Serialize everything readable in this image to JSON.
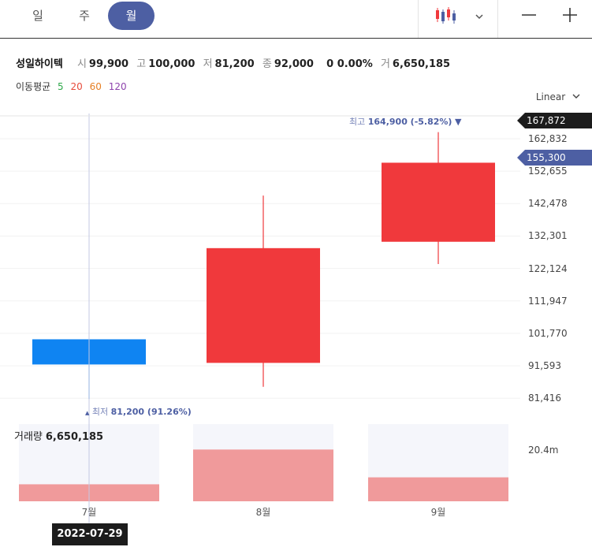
{
  "toolbar": {
    "tabs": [
      {
        "label": "일",
        "active": false
      },
      {
        "label": "주",
        "active": false
      },
      {
        "label": "월",
        "active": true
      }
    ],
    "chart_type_icon": "candlestick-icon",
    "dropdown_icon": "chevron-down-icon",
    "zoom_out_icon": "minus-icon",
    "zoom_in_icon": "plus-icon"
  },
  "quote": {
    "name": "성일하이텍",
    "open_label": "시",
    "open": "99,900",
    "high_label": "고",
    "high": "100,000",
    "low_label": "저",
    "low": "81,200",
    "close_label": "종",
    "close": "92,000",
    "change": "0 0.00%",
    "volume_label": "거",
    "volume": "6,650,185"
  },
  "moving_average": {
    "label": "이동평균",
    "periods": [
      {
        "value": "5",
        "color": "#2ea84a"
      },
      {
        "value": "20",
        "color": "#e74c3c"
      },
      {
        "value": "60",
        "color": "#e67e22"
      },
      {
        "value": "120",
        "color": "#8e44ad"
      }
    ]
  },
  "scale_mode": "Linear",
  "colors": {
    "up": "#f0393c",
    "down": "#0f84f2",
    "accent": "#4d5fa3",
    "volume_up": "#f09a9b",
    "volume_bg": "#f5f6fb"
  },
  "chart_data": {
    "type": "candlestick",
    "categories": [
      "7월",
      "8월",
      "9월"
    ],
    "candles": [
      {
        "open": 99900,
        "high": 100000,
        "low": 81200,
        "close": 92000,
        "direction": "down"
      },
      {
        "open": 92500,
        "high": 145000,
        "low": 85000,
        "close": 128500,
        "direction": "up"
      },
      {
        "open": 130500,
        "high": 164900,
        "low": 123500,
        "close": 155300,
        "direction": "up"
      }
    ],
    "volume": [
      0.22,
      0.67,
      0.31
    ],
    "y_range": [
      79000,
      170000
    ],
    "y_ticks": [
      {
        "value": 162832,
        "label": "162,832"
      },
      {
        "value": 152655,
        "label": "152,655"
      },
      {
        "value": 142478,
        "label": "142,478"
      },
      {
        "value": 132301,
        "label": "132,301"
      },
      {
        "value": 122124,
        "label": "122,124"
      },
      {
        "value": 111947,
        "label": "111,947"
      },
      {
        "value": 101770,
        "label": "101,770"
      },
      {
        "value": 91593,
        "label": "91,593"
      },
      {
        "value": 81416,
        "label": "81,416"
      }
    ],
    "max_price_tag": "167,872",
    "current_price_tag": "155,300",
    "high_note": {
      "label": "최고",
      "value": "164,900 (-5.82%)",
      "marker": "▼"
    },
    "low_note": {
      "label": "최저",
      "value": "81,200 (91.26%)",
      "marker": "▲"
    },
    "volume_title": "거래량",
    "volume_value": "6,650,185",
    "volume_axis_label": "20.4m",
    "crosshair_date": "2022-07-29"
  }
}
